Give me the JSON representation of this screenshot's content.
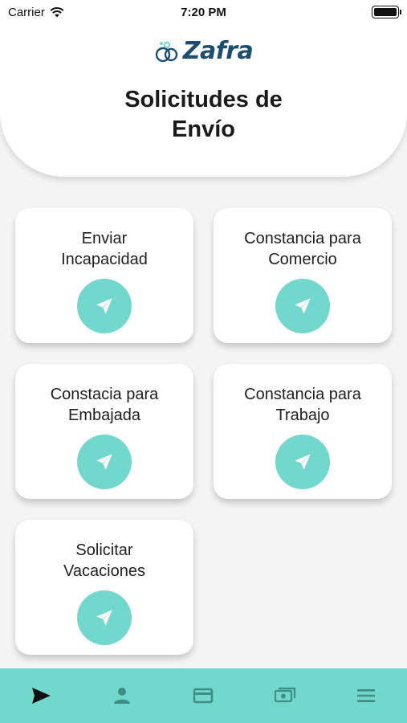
{
  "status_bar": {
    "carrier": "Carrier",
    "time": "7:20 PM"
  },
  "header": {
    "logo_text": "Zafra",
    "title": "Solicitudes de\nEnvío"
  },
  "cards": [
    {
      "label": "Enviar\nIncapacidad",
      "icon": "send-icon"
    },
    {
      "label": "Constancia para\nComercio",
      "icon": "send-icon"
    },
    {
      "label": "Constacia para\nEmbajada",
      "icon": "send-icon"
    },
    {
      "label": "Constancia para\nTrabajo",
      "icon": "send-icon"
    },
    {
      "label": "Solicitar\nVacaciones",
      "icon": "send-icon"
    }
  ],
  "tab_bar": {
    "tabs": [
      {
        "icon": "send-icon",
        "active": true
      },
      {
        "icon": "person-icon",
        "active": false
      },
      {
        "icon": "card-icon",
        "active": false
      },
      {
        "icon": "cash-icon",
        "active": false
      },
      {
        "icon": "menu-icon",
        "active": false
      }
    ]
  },
  "colors": {
    "accent": "#72d8cd",
    "logo": "#1d4e6f",
    "background": "#f4f4f4"
  }
}
